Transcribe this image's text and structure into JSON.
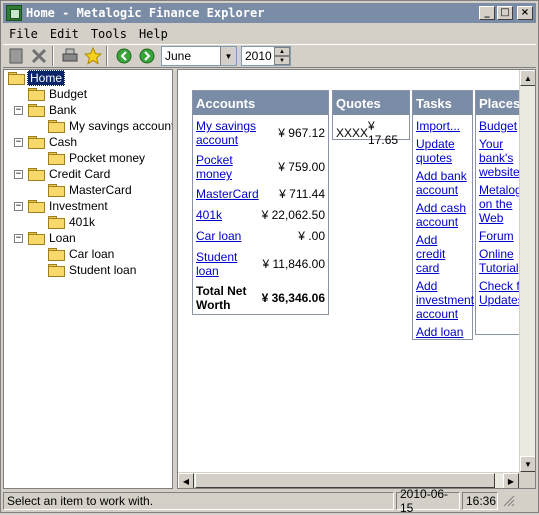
{
  "window": {
    "title": "Home - Metalogic Finance Explorer"
  },
  "menu": [
    "File",
    "Edit",
    "Tools",
    "Help"
  ],
  "toolbar": {
    "month": "June",
    "year": "2010"
  },
  "tree": {
    "items": [
      {
        "label": "Home"
      },
      {
        "label": "Budget"
      },
      {
        "label": "Bank"
      },
      {
        "label": "My savings account"
      },
      {
        "label": "Cash"
      },
      {
        "label": "Pocket money"
      },
      {
        "label": "Credit Card"
      },
      {
        "label": "MasterCard"
      },
      {
        "label": "Investment"
      },
      {
        "label": "401k"
      },
      {
        "label": "Loan"
      },
      {
        "label": "Car loan"
      },
      {
        "label": "Student loan"
      }
    ]
  },
  "accounts": {
    "header": "Accounts",
    "rows": [
      {
        "name": "My savings account",
        "amount": "¥ 967.12"
      },
      {
        "name": "Pocket money",
        "amount": "¥ 759.00"
      },
      {
        "name": "MasterCard",
        "amount": "¥ 711.44"
      },
      {
        "name": "401k",
        "amount": "¥ 22,062.50"
      },
      {
        "name": "Car loan",
        "amount": "¥ .00"
      },
      {
        "name": "Student loan",
        "amount": "¥ 11,846.00"
      }
    ],
    "total_label": "Total Net Worth",
    "total_amount": "¥ 36,346.06"
  },
  "quotes": {
    "header": "Quotes",
    "rows": [
      {
        "symbol": "XXXX",
        "price": "¥ 17.65"
      }
    ]
  },
  "tasks": {
    "header": "Tasks",
    "items": [
      "Import...",
      "Update quotes",
      "Add bank account",
      "Add cash account",
      "Add credit card",
      "Add investment account",
      "Add loan"
    ]
  },
  "places": {
    "header": "Places",
    "items": [
      "Budget",
      "Your bank's website",
      "Metalogic on the Web",
      "Forum",
      "Online Tutorial",
      "Check for Updates"
    ]
  },
  "status": {
    "message": "Select an item to work with.",
    "date": "2010-06-15",
    "time": "16:36"
  }
}
